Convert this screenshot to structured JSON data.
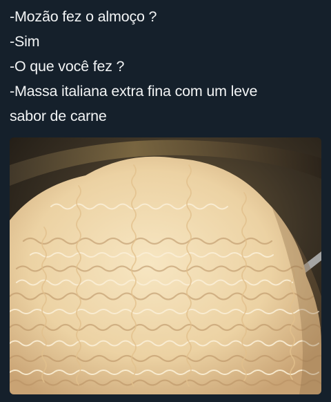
{
  "post": {
    "lines": [
      "-Mozão fez o almoço ?",
      "-Sim",
      "-O que você fez ?",
      "-Massa italiana extra fina com um leve",
      "sabor de carne"
    ]
  },
  "photo": {
    "subject": "noodles-in-bowl",
    "colors": {
      "background": "#15202b",
      "noodle_light": "#f3dfb8",
      "noodle_mid": "#e6c996",
      "noodle_shadow": "#b89062",
      "bowl_dark": "#2a241b"
    }
  }
}
